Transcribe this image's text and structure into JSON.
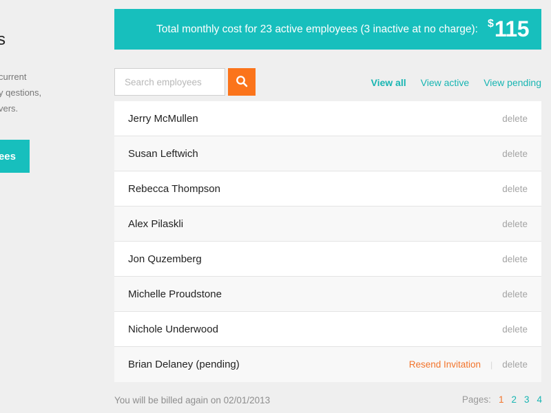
{
  "sidebar": {
    "heading": "s",
    "description_lines": [
      "current",
      "y qestions,",
      "vers."
    ],
    "button_label": "ees"
  },
  "banner": {
    "text": "Total monthly cost for 23 active employees (3 inactive at no charge):",
    "currency": "$",
    "amount": "115"
  },
  "search": {
    "placeholder": "Search employees",
    "value": ""
  },
  "filters": [
    {
      "label": "View all",
      "active": true
    },
    {
      "label": "View active",
      "active": false
    },
    {
      "label": "View pending",
      "active": false
    }
  ],
  "employees": [
    {
      "name": "Jerry McMullen",
      "delete_label": "delete"
    },
    {
      "name": "Susan Leftwich",
      "delete_label": "delete"
    },
    {
      "name": "Rebecca Thompson",
      "delete_label": "delete"
    },
    {
      "name": "Alex Pilaskli",
      "delete_label": "delete"
    },
    {
      "name": "Jon Quzemberg",
      "delete_label": "delete"
    },
    {
      "name": "Michelle Proudstone",
      "delete_label": "delete"
    },
    {
      "name": "Nichole Underwood",
      "delete_label": "delete"
    },
    {
      "name": "Brian Delaney (pending)",
      "resend_label": "Resend Invitation",
      "separator": "|",
      "delete_label": "delete"
    }
  ],
  "footer": {
    "billing_text": "You will be billed again on 02/01/2013",
    "pages_label": "Pages:",
    "pages": [
      "1",
      "2",
      "3",
      "4"
    ],
    "current_page": "1"
  },
  "colors": {
    "accent": "#17bfbd",
    "orange": "#fb741b",
    "background": "#efefef"
  },
  "icons": {
    "search_button": "search-icon"
  }
}
